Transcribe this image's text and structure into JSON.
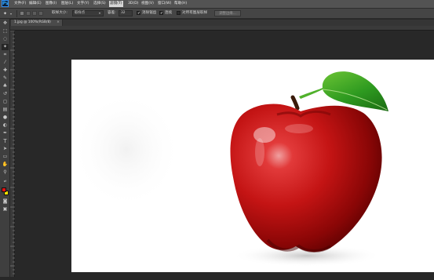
{
  "app": {
    "logo": "Ps"
  },
  "menubar": {
    "items": [
      "文件(F)",
      "编辑(E)",
      "图像(I)",
      "图层(L)",
      "文字(Y)",
      "选择(S)",
      "滤镜(T)",
      "3D(D)",
      "视图(V)",
      "窗口(W)",
      "帮助(H)"
    ],
    "active_index": 6
  },
  "options_bar": {
    "sample_size_label": "取样大小:",
    "sample_size_value": "取样点",
    "tolerance_label": "容差:",
    "tolerance_value": "32",
    "antialias_label": "消除锯齿",
    "contiguous_label": "连续",
    "sample_all_label": "对所有图层取样",
    "refine_edge_label": "调整边缘..."
  },
  "document": {
    "tab_title": "1.jpg @ 100%(RGB/8)",
    "close_glyph": "×"
  },
  "colors": {
    "foreground": "#e01010",
    "background": "#f5e000"
  }
}
